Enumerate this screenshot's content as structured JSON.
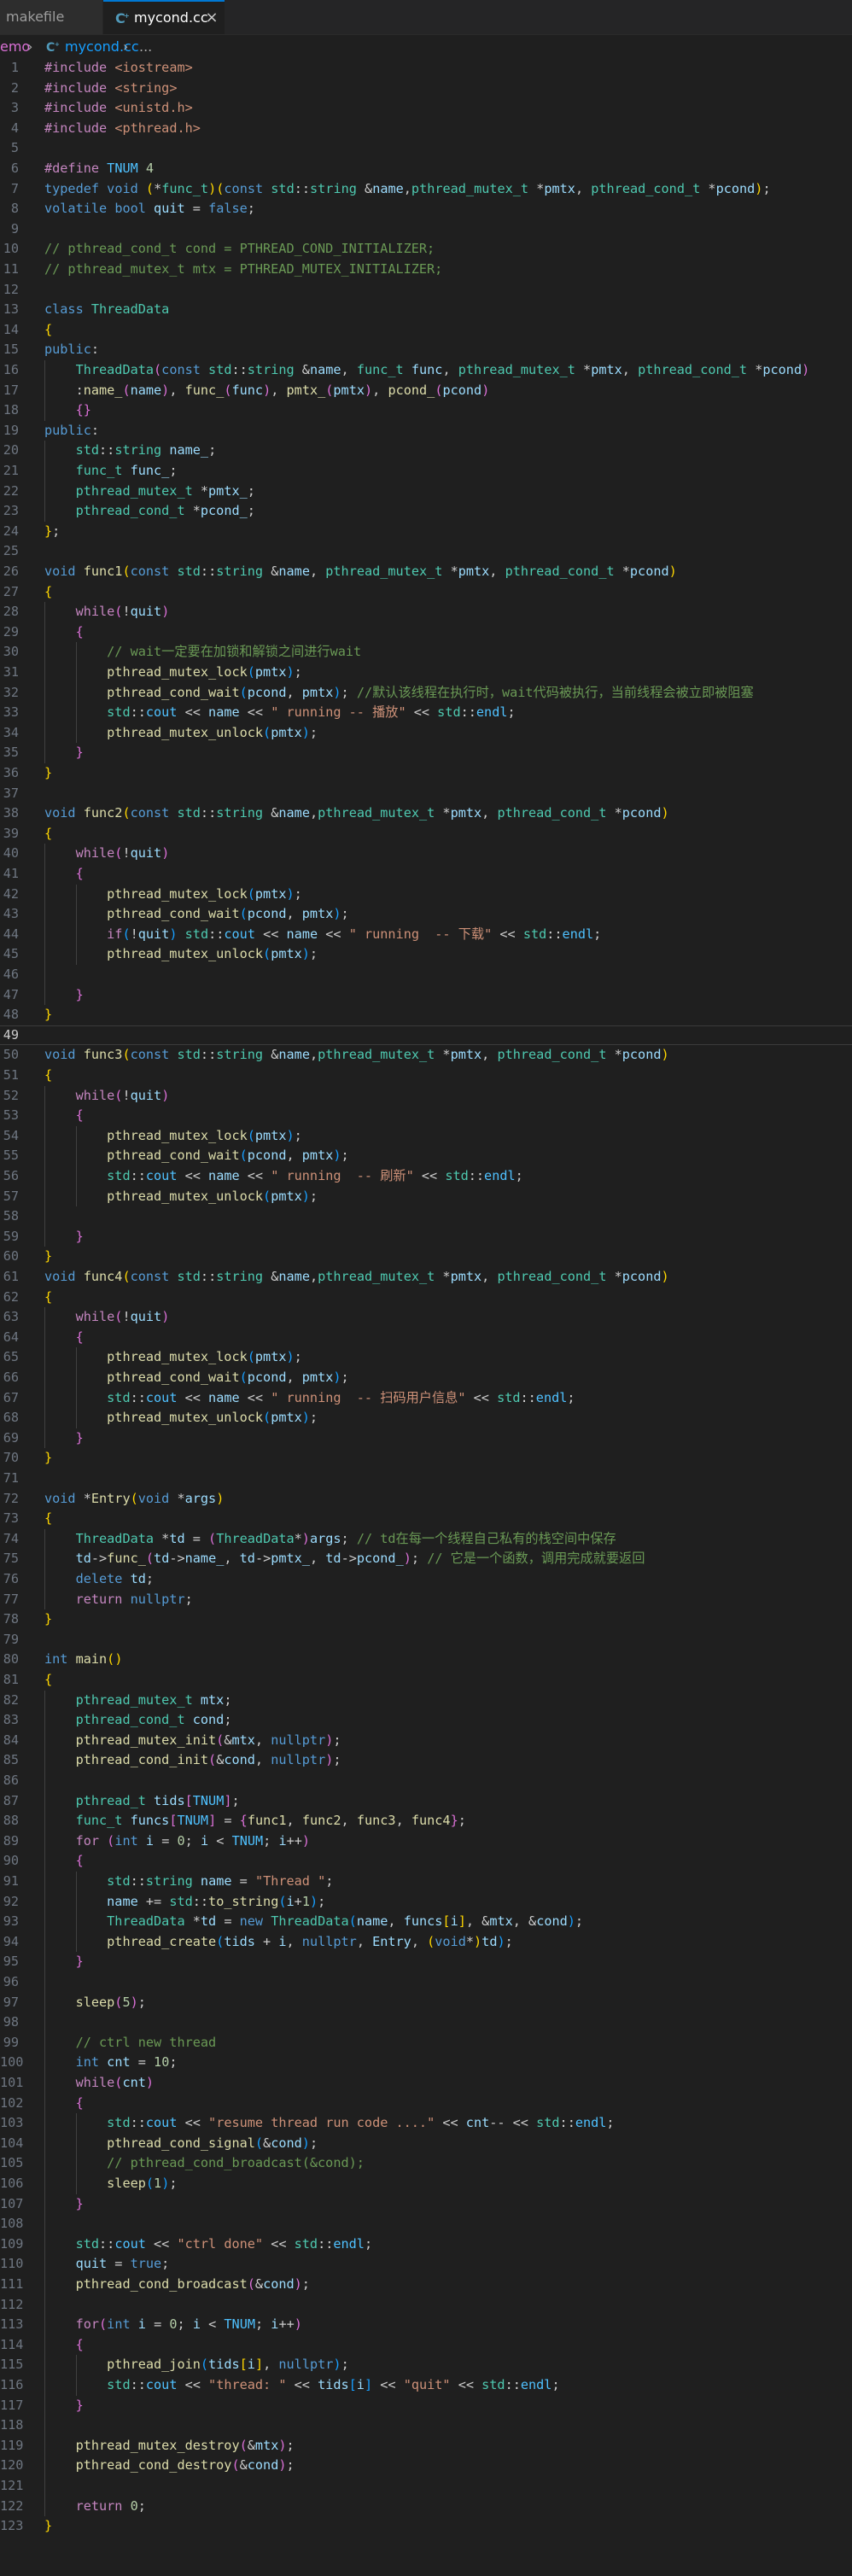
{
  "tabs": [
    {
      "label": "makefile",
      "active": false
    },
    {
      "label": "mycond.cc",
      "active": true,
      "close_glyph": "×"
    }
  ],
  "breadcrumb": {
    "segments": [
      "emo",
      "mycond.cc",
      "..."
    ],
    "separator": "›",
    "file_icon": "c-file-icon"
  },
  "editor": {
    "language": "cpp",
    "cursor_line": 49,
    "lines": [
      {
        "n": "1",
        "code": "#include <iostream>"
      },
      {
        "n": "2",
        "code": "#include <string>"
      },
      {
        "n": "3",
        "code": "#include <unistd.h>"
      },
      {
        "n": "4",
        "code": "#include <pthread.h>"
      },
      {
        "n": "5",
        "code": ""
      },
      {
        "n": "6",
        "code": "#define TNUM 4"
      },
      {
        "n": "7",
        "code": "typedef void (*func_t)(const std::string &name,pthread_mutex_t *pmtx, pthread_cond_t *pcond);"
      },
      {
        "n": "8",
        "code": "volatile bool quit = false;"
      },
      {
        "n": "9",
        "code": ""
      },
      {
        "n": "10",
        "code": "// pthread_cond_t cond = PTHREAD_COND_INITIALIZER;"
      },
      {
        "n": "11",
        "code": "// pthread_mutex_t mtx = PTHREAD_MUTEX_INITIALIZER;"
      },
      {
        "n": "12",
        "code": ""
      },
      {
        "n": "13",
        "code": "class ThreadData"
      },
      {
        "n": "14",
        "code": "{"
      },
      {
        "n": "15",
        "code": "public:"
      },
      {
        "n": "16",
        "code": "    ThreadData(const std::string &name, func_t func, pthread_mutex_t *pmtx, pthread_cond_t *pcond)"
      },
      {
        "n": "17",
        "code": "    :name_(name), func_(func), pmtx_(pmtx), pcond_(pcond)"
      },
      {
        "n": "18",
        "code": "    {}"
      },
      {
        "n": "19",
        "code": "public:"
      },
      {
        "n": "20",
        "code": "    std::string name_;"
      },
      {
        "n": "21",
        "code": "    func_t func_;"
      },
      {
        "n": "22",
        "code": "    pthread_mutex_t *pmtx_;"
      },
      {
        "n": "23",
        "code": "    pthread_cond_t *pcond_;"
      },
      {
        "n": "24",
        "code": "};"
      },
      {
        "n": "25",
        "code": ""
      },
      {
        "n": "26",
        "code": "void func1(const std::string &name, pthread_mutex_t *pmtx, pthread_cond_t *pcond)"
      },
      {
        "n": "27",
        "code": "{"
      },
      {
        "n": "28",
        "code": "    while(!quit)"
      },
      {
        "n": "29",
        "code": "    {"
      },
      {
        "n": "30",
        "code": "        // wait一定要在加锁和解锁之间进行wait"
      },
      {
        "n": "31",
        "code": "        pthread_mutex_lock(pmtx);"
      },
      {
        "n": "32",
        "code": "        pthread_cond_wait(pcond, pmtx); //默认该线程在执行时，wait代码被执行，当前线程会被立即被阻塞"
      },
      {
        "n": "33",
        "code": "        std::cout << name << \" running -- 播放\" << std::endl;"
      },
      {
        "n": "34",
        "code": "        pthread_mutex_unlock(pmtx);"
      },
      {
        "n": "35",
        "code": "    }"
      },
      {
        "n": "36",
        "code": "}"
      },
      {
        "n": "37",
        "code": ""
      },
      {
        "n": "38",
        "code": "void func2(const std::string &name,pthread_mutex_t *pmtx, pthread_cond_t *pcond)"
      },
      {
        "n": "39",
        "code": "{"
      },
      {
        "n": "40",
        "code": "    while(!quit)"
      },
      {
        "n": "41",
        "code": "    {"
      },
      {
        "n": "42",
        "code": "        pthread_mutex_lock(pmtx);"
      },
      {
        "n": "43",
        "code": "        pthread_cond_wait(pcond, pmtx);"
      },
      {
        "n": "44",
        "code": "        if(!quit) std::cout << name << \" running  -- 下载\" << std::endl;"
      },
      {
        "n": "45",
        "code": "        pthread_mutex_unlock(pmtx);"
      },
      {
        "n": "46",
        "code": ""
      },
      {
        "n": "47",
        "code": "    }"
      },
      {
        "n": "48",
        "code": "}"
      },
      {
        "n": "49",
        "code": ""
      },
      {
        "n": "50",
        "code": "void func3(const std::string &name,pthread_mutex_t *pmtx, pthread_cond_t *pcond)"
      },
      {
        "n": "51",
        "code": "{"
      },
      {
        "n": "52",
        "code": "    while(!quit)"
      },
      {
        "n": "53",
        "code": "    {"
      },
      {
        "n": "54",
        "code": "        pthread_mutex_lock(pmtx);"
      },
      {
        "n": "55",
        "code": "        pthread_cond_wait(pcond, pmtx);"
      },
      {
        "n": "56",
        "code": "        std::cout << name << \" running  -- 刷新\" << std::endl;"
      },
      {
        "n": "57",
        "code": "        pthread_mutex_unlock(pmtx);"
      },
      {
        "n": "58",
        "code": ""
      },
      {
        "n": "59",
        "code": "    }"
      },
      {
        "n": "60",
        "code": "}"
      },
      {
        "n": "61",
        "code": "void func4(const std::string &name,pthread_mutex_t *pmtx, pthread_cond_t *pcond)"
      },
      {
        "n": "62",
        "code": "{"
      },
      {
        "n": "63",
        "code": "    while(!quit)"
      },
      {
        "n": "64",
        "code": "    {"
      },
      {
        "n": "65",
        "code": "        pthread_mutex_lock(pmtx);"
      },
      {
        "n": "66",
        "code": "        pthread_cond_wait(pcond, pmtx);"
      },
      {
        "n": "67",
        "code": "        std::cout << name << \" running  -- 扫码用户信息\" << std::endl;"
      },
      {
        "n": "68",
        "code": "        pthread_mutex_unlock(pmtx);"
      },
      {
        "n": "69",
        "code": "    }"
      },
      {
        "n": "70",
        "code": "}"
      },
      {
        "n": "71",
        "code": ""
      },
      {
        "n": "72",
        "code": "void *Entry(void *args)"
      },
      {
        "n": "73",
        "code": "{"
      },
      {
        "n": "74",
        "code": "    ThreadData *td = (ThreadData*)args; // td在每一个线程自己私有的栈空间中保存"
      },
      {
        "n": "75",
        "code": "    td->func_(td->name_, td->pmtx_, td->pcond_); // 它是一个函数，调用完成就要返回"
      },
      {
        "n": "76",
        "code": "    delete td;"
      },
      {
        "n": "77",
        "code": "    return nullptr;"
      },
      {
        "n": "78",
        "code": "}"
      },
      {
        "n": "79",
        "code": ""
      },
      {
        "n": "80",
        "code": "int main()"
      },
      {
        "n": "81",
        "code": "{"
      },
      {
        "n": "82",
        "code": "    pthread_mutex_t mtx;"
      },
      {
        "n": "83",
        "code": "    pthread_cond_t cond;"
      },
      {
        "n": "84",
        "code": "    pthread_mutex_init(&mtx, nullptr);"
      },
      {
        "n": "85",
        "code": "    pthread_cond_init(&cond, nullptr);"
      },
      {
        "n": "86",
        "code": ""
      },
      {
        "n": "87",
        "code": "    pthread_t tids[TNUM];"
      },
      {
        "n": "88",
        "code": "    func_t funcs[TNUM] = {func1, func2, func3, func4};"
      },
      {
        "n": "89",
        "code": "    for (int i = 0; i < TNUM; i++)"
      },
      {
        "n": "90",
        "code": "    {"
      },
      {
        "n": "91",
        "code": "        std::string name = \"Thread \";"
      },
      {
        "n": "92",
        "code": "        name += std::to_string(i+1);"
      },
      {
        "n": "93",
        "code": "        ThreadData *td = new ThreadData(name, funcs[i], &mtx, &cond);"
      },
      {
        "n": "94",
        "code": "        pthread_create(tids + i, nullptr, Entry, (void*)td);"
      },
      {
        "n": "95",
        "code": "    }"
      },
      {
        "n": "96",
        "code": ""
      },
      {
        "n": "97",
        "code": "    sleep(5);"
      },
      {
        "n": "98",
        "code": ""
      },
      {
        "n": "99",
        "code": "    // ctrl new thread"
      },
      {
        "n": "100",
        "code": "    int cnt = 10;"
      },
      {
        "n": "101",
        "code": "    while(cnt)"
      },
      {
        "n": "102",
        "code": "    {"
      },
      {
        "n": "103",
        "code": "        std::cout << \"resume thread run code ....\" << cnt-- << std::endl;"
      },
      {
        "n": "104",
        "code": "        pthread_cond_signal(&cond);"
      },
      {
        "n": "105",
        "code": "        // pthread_cond_broadcast(&cond);"
      },
      {
        "n": "106",
        "code": "        sleep(1);"
      },
      {
        "n": "107",
        "code": "    }"
      },
      {
        "n": "108",
        "code": ""
      },
      {
        "n": "109",
        "code": "    std::cout << \"ctrl done\" << std::endl;"
      },
      {
        "n": "110",
        "code": "    quit = true;"
      },
      {
        "n": "111",
        "code": "    pthread_cond_broadcast(&cond);"
      },
      {
        "n": "112",
        "code": ""
      },
      {
        "n": "113",
        "code": "    for(int i = 0; i < TNUM; i++)"
      },
      {
        "n": "114",
        "code": "    {"
      },
      {
        "n": "115",
        "code": "        pthread_join(tids[i], nullptr);"
      },
      {
        "n": "116",
        "code": "        std::cout << \"thread: \" << tids[i] << \"quit\" << std::endl;"
      },
      {
        "n": "117",
        "code": "    }"
      },
      {
        "n": "118",
        "code": ""
      },
      {
        "n": "119",
        "code": "    pthread_mutex_destroy(&mtx);"
      },
      {
        "n": "120",
        "code": "    pthread_cond_destroy(&cond);"
      },
      {
        "n": "121",
        "code": ""
      },
      {
        "n": "122",
        "code": "    return 0;"
      },
      {
        "n": "123",
        "code": "}"
      }
    ]
  },
  "colors": {
    "editor_bg": "#1f1f1f",
    "tab_bar_bg": "#252526",
    "active_tab_border": "#0078d4",
    "line_number": "#6e7681",
    "keyword": "#569cd6",
    "control": "#c586c0",
    "type": "#4ec9b0",
    "function": "#dcdcaa",
    "variable": "#9cdcfe",
    "string": "#ce9178",
    "number": "#b5cea8",
    "comment": "#6a9955"
  }
}
